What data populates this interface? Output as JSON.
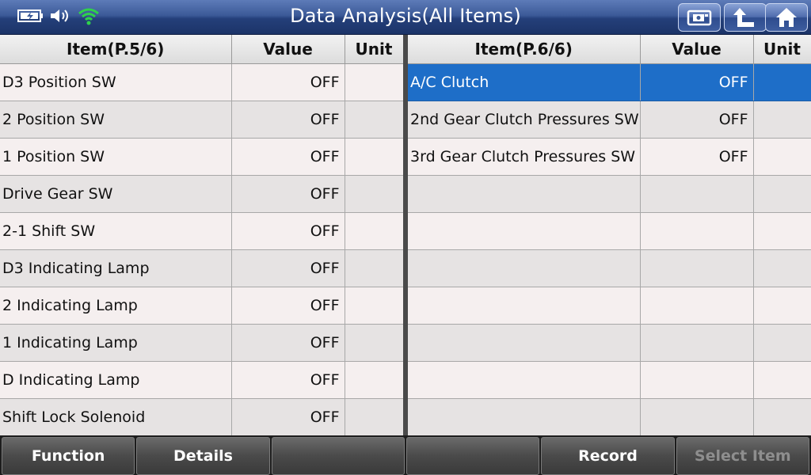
{
  "header": {
    "title": "Data Analysis(All Items)",
    "status_icons": [
      "battery-icon",
      "speaker-icon",
      "wifi-icon"
    ],
    "buttons": [
      "screenshot-icon",
      "back-icon",
      "home-icon"
    ]
  },
  "left_table": {
    "columns": [
      "Item(P.5/6)",
      "Value",
      "Unit"
    ],
    "rows": [
      {
        "item": "D3 Position SW",
        "value": "OFF",
        "unit": ""
      },
      {
        "item": "2 Position SW",
        "value": "OFF",
        "unit": ""
      },
      {
        "item": "1 Position SW",
        "value": "OFF",
        "unit": ""
      },
      {
        "item": "Drive Gear SW",
        "value": "OFF",
        "unit": ""
      },
      {
        "item": "2-1 Shift SW",
        "value": "OFF",
        "unit": ""
      },
      {
        "item": "D3 Indicating Lamp",
        "value": "OFF",
        "unit": ""
      },
      {
        "item": "2 Indicating Lamp",
        "value": "OFF",
        "unit": ""
      },
      {
        "item": "1 Indicating Lamp",
        "value": "OFF",
        "unit": ""
      },
      {
        "item": "D Indicating Lamp",
        "value": "OFF",
        "unit": ""
      },
      {
        "item": "Shift Lock Solenoid",
        "value": "OFF",
        "unit": ""
      }
    ]
  },
  "right_table": {
    "columns": [
      "Item(P.6/6)",
      "Value",
      "Unit"
    ],
    "selected_row": 0,
    "rows": [
      {
        "item": "A/C Clutch",
        "value": "OFF",
        "unit": ""
      },
      {
        "item": "2nd Gear Clutch Pressures SW",
        "value": "OFF",
        "unit": ""
      },
      {
        "item": "3rd Gear Clutch Pressures SW",
        "value": "OFF",
        "unit": ""
      },
      {
        "item": "",
        "value": "",
        "unit": ""
      },
      {
        "item": "",
        "value": "",
        "unit": ""
      },
      {
        "item": "",
        "value": "",
        "unit": ""
      },
      {
        "item": "",
        "value": "",
        "unit": ""
      },
      {
        "item": "",
        "value": "",
        "unit": ""
      },
      {
        "item": "",
        "value": "",
        "unit": ""
      },
      {
        "item": "",
        "value": "",
        "unit": ""
      }
    ]
  },
  "footer": {
    "buttons": [
      {
        "label": "Function",
        "enabled": true
      },
      {
        "label": "Details",
        "enabled": true
      },
      {
        "label": "",
        "enabled": true
      },
      {
        "label": "",
        "enabled": true
      },
      {
        "label": "Record",
        "enabled": true
      },
      {
        "label": "Select Item",
        "enabled": false
      }
    ]
  },
  "colors": {
    "header_bg": "#243f7a",
    "selection": "#1e6ec8",
    "wifi": "#2fd24a"
  }
}
